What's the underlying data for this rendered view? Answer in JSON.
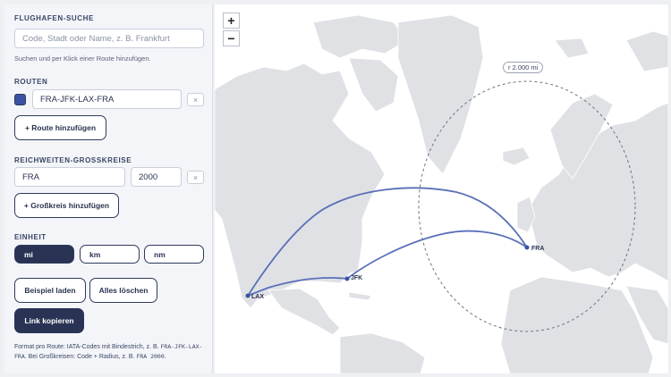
{
  "search": {
    "title": "FLUGHAFEN-SUCHE",
    "placeholder": "Code, Stadt oder Name, z. B. Frankfurt",
    "hint": "Suchen und per Klick einer Route hinzufügen."
  },
  "routes": {
    "title": "ROUTEN",
    "items": [
      {
        "value": "FRA-JFK-LAX-FRA",
        "color": "#3b52a4"
      }
    ],
    "remove_label": "×",
    "add_label": "+ Route hinzufügen"
  },
  "circles": {
    "title": "REICHWEITEN-GROSSKREISE",
    "items": [
      {
        "airport": "FRA",
        "radius": "2000"
      }
    ],
    "remove_label": "×",
    "add_label": "+ Großkreis hinzufügen"
  },
  "units": {
    "title": "EINHEIT",
    "options": [
      "mi",
      "km",
      "nm"
    ],
    "selected": "mi"
  },
  "actions": {
    "load_example": "Beispiel laden",
    "clear_all": "Alles löschen",
    "copy_link": "Link kopieren"
  },
  "footer": {
    "text_1": "Format pro Route: IATA-Codes mit Bindestrich, z. B. ",
    "code_1": "FRA-JFK-LAX-FRA",
    "text_2": ". Bei Großkreisen: Code + Radius, z. B. ",
    "code_2": "FRA 2000",
    "text_3": "."
  },
  "map": {
    "zoom_in": "+",
    "zoom_out": "−",
    "radius_label": "r 2.000 mi",
    "airports": [
      "FRA",
      "JFK",
      "LAX"
    ],
    "route_color": "#5a6fb8",
    "land_color": "#dfe1e5",
    "water_color": "#ffffff"
  }
}
